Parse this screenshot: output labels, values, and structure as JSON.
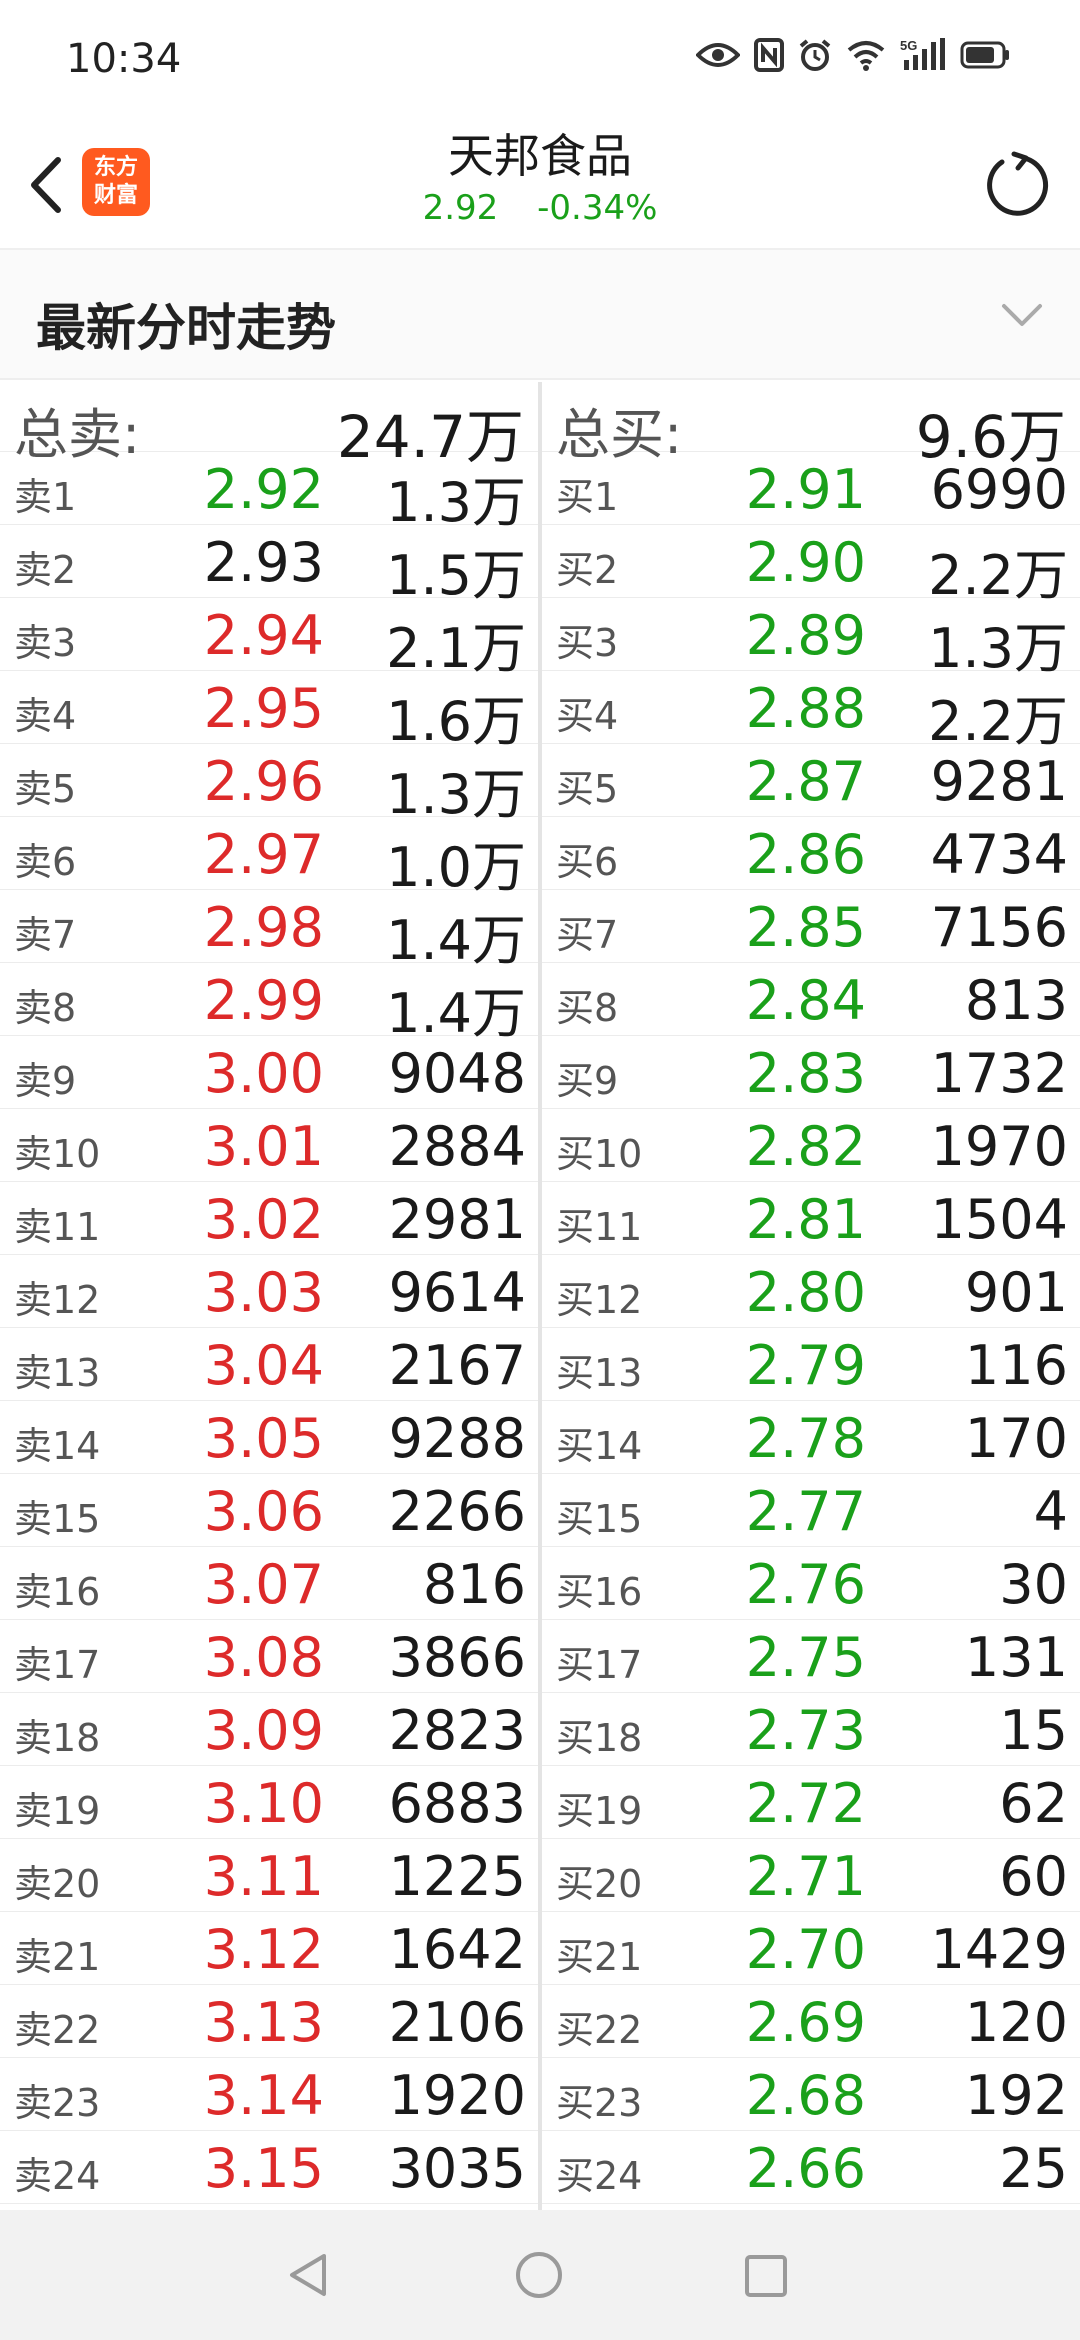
{
  "status_bar": {
    "time": "10:34",
    "icons": [
      "eye-icon",
      "nfc-icon",
      "alarm-icon",
      "wifi-icon",
      "5g-signal-icon",
      "battery-icon"
    ]
  },
  "header": {
    "logo_line1": "东方",
    "logo_line2": "财富",
    "stock_name": "天邦食品",
    "price": "2.92",
    "change_pct": "-0.34%"
  },
  "section": {
    "title": "最新分时走势"
  },
  "colors": {
    "green": "#1aa01a",
    "red": "#dd2a2a",
    "logo": "#ff5a1f"
  },
  "order_book": {
    "sell_total_label": "总卖:",
    "sell_total_value": "24.7万",
    "buy_total_label": "总买:",
    "buy_total_value": "9.6万",
    "sell": [
      {
        "label": "卖1",
        "price": "2.92",
        "qty": "1.3万",
        "color": "green"
      },
      {
        "label": "卖2",
        "price": "2.93",
        "qty": "1.5万",
        "color": "neutral"
      },
      {
        "label": "卖3",
        "price": "2.94",
        "qty": "2.1万",
        "color": "red"
      },
      {
        "label": "卖4",
        "price": "2.95",
        "qty": "1.6万",
        "color": "red"
      },
      {
        "label": "卖5",
        "price": "2.96",
        "qty": "1.3万",
        "color": "red"
      },
      {
        "label": "卖6",
        "price": "2.97",
        "qty": "1.0万",
        "color": "red"
      },
      {
        "label": "卖7",
        "price": "2.98",
        "qty": "1.4万",
        "color": "red"
      },
      {
        "label": "卖8",
        "price": "2.99",
        "qty": "1.4万",
        "color": "red"
      },
      {
        "label": "卖9",
        "price": "3.00",
        "qty": "9048",
        "color": "red"
      },
      {
        "label": "卖10",
        "price": "3.01",
        "qty": "2884",
        "color": "red"
      },
      {
        "label": "卖11",
        "price": "3.02",
        "qty": "2981",
        "color": "red"
      },
      {
        "label": "卖12",
        "price": "3.03",
        "qty": "9614",
        "color": "red"
      },
      {
        "label": "卖13",
        "price": "3.04",
        "qty": "2167",
        "color": "red"
      },
      {
        "label": "卖14",
        "price": "3.05",
        "qty": "9288",
        "color": "red"
      },
      {
        "label": "卖15",
        "price": "3.06",
        "qty": "2266",
        "color": "red"
      },
      {
        "label": "卖16",
        "price": "3.07",
        "qty": "816",
        "color": "red"
      },
      {
        "label": "卖17",
        "price": "3.08",
        "qty": "3866",
        "color": "red"
      },
      {
        "label": "卖18",
        "price": "3.09",
        "qty": "2823",
        "color": "red"
      },
      {
        "label": "卖19",
        "price": "3.10",
        "qty": "6883",
        "color": "red"
      },
      {
        "label": "卖20",
        "price": "3.11",
        "qty": "1225",
        "color": "red"
      },
      {
        "label": "卖21",
        "price": "3.12",
        "qty": "1642",
        "color": "red"
      },
      {
        "label": "卖22",
        "price": "3.13",
        "qty": "2106",
        "color": "red"
      },
      {
        "label": "卖23",
        "price": "3.14",
        "qty": "1920",
        "color": "red"
      },
      {
        "label": "卖24",
        "price": "3.15",
        "qty": "3035",
        "color": "red"
      }
    ],
    "buy": [
      {
        "label": "买1",
        "price": "2.91",
        "qty": "6990",
        "color": "green"
      },
      {
        "label": "买2",
        "price": "2.90",
        "qty": "2.2万",
        "color": "green"
      },
      {
        "label": "买3",
        "price": "2.89",
        "qty": "1.3万",
        "color": "green"
      },
      {
        "label": "买4",
        "price": "2.88",
        "qty": "2.2万",
        "color": "green"
      },
      {
        "label": "买5",
        "price": "2.87",
        "qty": "9281",
        "color": "green"
      },
      {
        "label": "买6",
        "price": "2.86",
        "qty": "4734",
        "color": "green"
      },
      {
        "label": "买7",
        "price": "2.85",
        "qty": "7156",
        "color": "green"
      },
      {
        "label": "买8",
        "price": "2.84",
        "qty": "813",
        "color": "green"
      },
      {
        "label": "买9",
        "price": "2.83",
        "qty": "1732",
        "color": "green"
      },
      {
        "label": "买10",
        "price": "2.82",
        "qty": "1970",
        "color": "green"
      },
      {
        "label": "买11",
        "price": "2.81",
        "qty": "1504",
        "color": "green"
      },
      {
        "label": "买12",
        "price": "2.80",
        "qty": "901",
        "color": "green"
      },
      {
        "label": "买13",
        "price": "2.79",
        "qty": "116",
        "color": "green"
      },
      {
        "label": "买14",
        "price": "2.78",
        "qty": "170",
        "color": "green"
      },
      {
        "label": "买15",
        "price": "2.77",
        "qty": "4",
        "color": "green"
      },
      {
        "label": "买16",
        "price": "2.76",
        "qty": "30",
        "color": "green"
      },
      {
        "label": "买17",
        "price": "2.75",
        "qty": "131",
        "color": "green"
      },
      {
        "label": "买18",
        "price": "2.73",
        "qty": "15",
        "color": "green"
      },
      {
        "label": "买19",
        "price": "2.72",
        "qty": "62",
        "color": "green"
      },
      {
        "label": "买20",
        "price": "2.71",
        "qty": "60",
        "color": "green"
      },
      {
        "label": "买21",
        "price": "2.70",
        "qty": "1429",
        "color": "green"
      },
      {
        "label": "买22",
        "price": "2.69",
        "qty": "120",
        "color": "green"
      },
      {
        "label": "买23",
        "price": "2.68",
        "qty": "192",
        "color": "green"
      },
      {
        "label": "买24",
        "price": "2.66",
        "qty": "25",
        "color": "green"
      }
    ]
  },
  "nav_bar": {
    "icons": [
      "nav-back-icon",
      "nav-home-icon",
      "nav-recent-icon"
    ]
  }
}
